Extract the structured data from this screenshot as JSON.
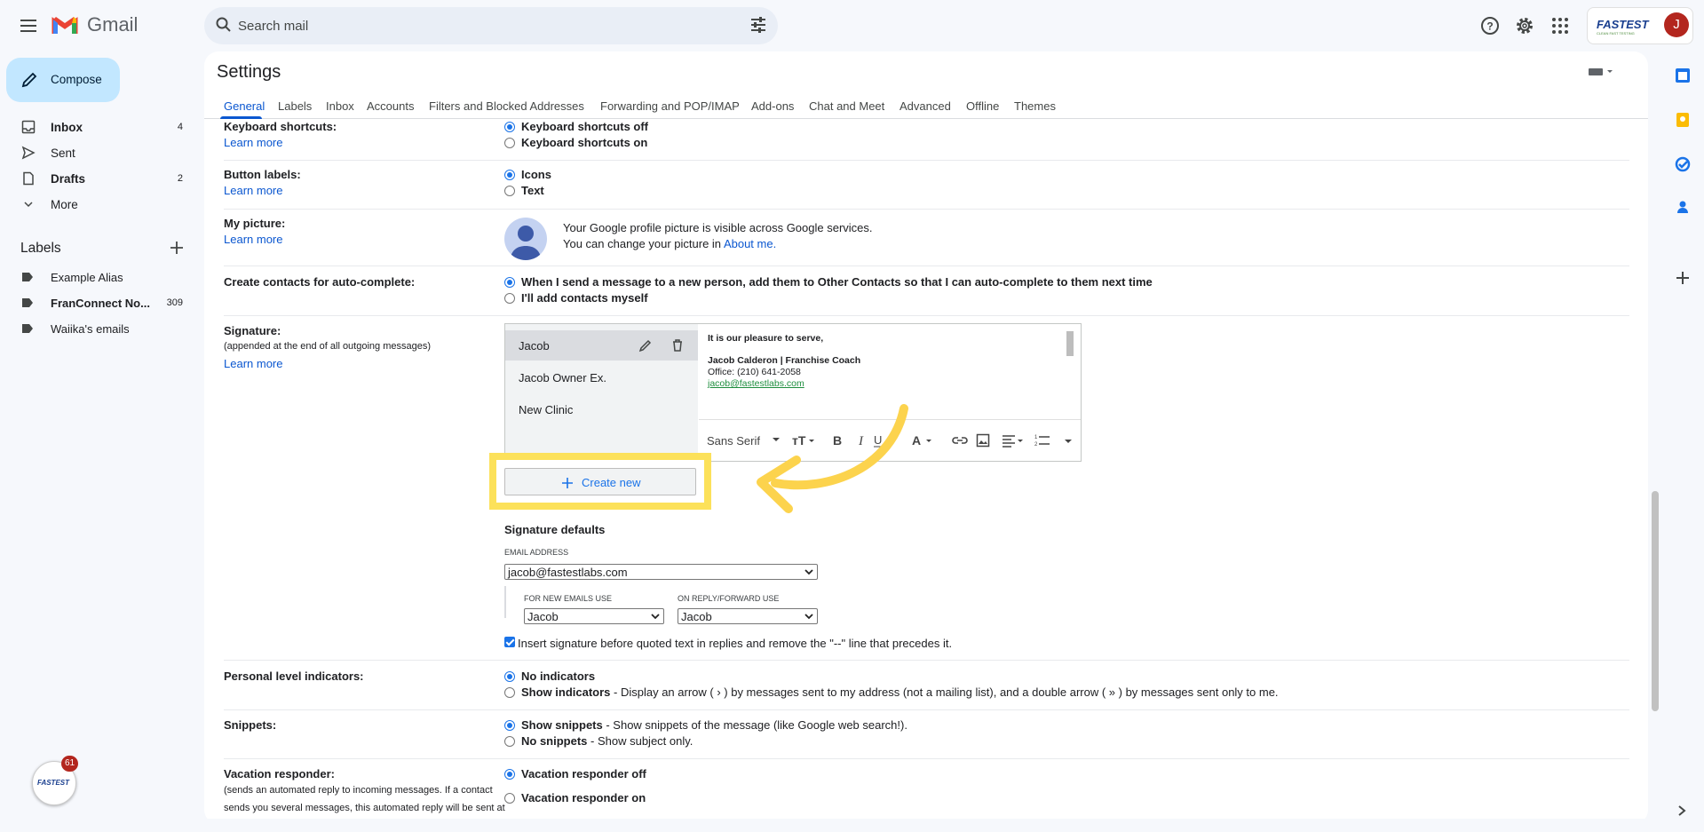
{
  "app": {
    "name": "Gmail"
  },
  "search": {
    "placeholder": "Search mail"
  },
  "account": {
    "brand": "FASTEST",
    "brand_sub": "CLEAN FAST TESTING",
    "avatar_letter": "J"
  },
  "sidebar": {
    "compose_label": "Compose",
    "items": [
      {
        "label": "Inbox",
        "count": "4"
      },
      {
        "label": "Sent",
        "count": ""
      },
      {
        "label": "Drafts",
        "count": "2"
      },
      {
        "label": "More",
        "count": ""
      }
    ],
    "labels_heading": "Labels",
    "labels": [
      {
        "label": "Example Alias",
        "count": ""
      },
      {
        "label": "FranConnect No...",
        "count": "309"
      },
      {
        "label": "Waiika's emails",
        "count": ""
      }
    ],
    "chat_badge": "61",
    "chat_brand": "FASTEST"
  },
  "settings": {
    "title": "Settings",
    "tabs": [
      "General",
      "Labels",
      "Inbox",
      "Accounts",
      "Filters and Blocked Addresses",
      "Forwarding and POP/IMAP",
      "Add-ons",
      "Chat and Meet",
      "Advanced",
      "Offline",
      "Themes"
    ],
    "learn_more": "Learn more",
    "keyboard": {
      "label": "Keyboard shortcuts:",
      "opt1": "Keyboard shortcuts off",
      "opt2": "Keyboard shortcuts on"
    },
    "buttons": {
      "label": "Button labels:",
      "opt1": "Icons",
      "opt2": "Text"
    },
    "picture": {
      "label": "My picture:",
      "line1": "Your Google profile picture is visible across Google services.",
      "line2": "You can change your picture in ",
      "link": "About me."
    },
    "contacts": {
      "label": "Create contacts for auto-complete:",
      "opt1": "When I send a message to a new person, add them to Other Contacts so that I can auto-complete to them next time",
      "opt2": "I'll add contacts myself"
    },
    "signature": {
      "label": "Signature:",
      "sub": "(appended at the end of all outgoing messages)",
      "items": [
        "Jacob",
        "Jacob Owner Ex.",
        "New Clinic"
      ],
      "text_line1": "It is our pleasure to serve,",
      "text_line2": "Jacob Calderon | Franchise Coach",
      "text_line3": "Office: (210) 641-2058",
      "text_link": "jacob@fastestlabs.com",
      "font": "Sans Serif",
      "create_new": "Create new",
      "defaults_title": "Signature defaults",
      "email_caption": "EMAIL ADDRESS",
      "email_value": "jacob@fastestlabs.com",
      "new_caption": "FOR NEW EMAILS USE",
      "new_value": "Jacob",
      "reply_caption": "ON REPLY/FORWARD USE",
      "reply_value": "Jacob",
      "insert_text": "Insert signature before quoted text in replies and remove the \"--\" line that precedes it."
    },
    "indicators": {
      "label": "Personal level indicators:",
      "opt1": "No indicators",
      "opt2_bold": "Show indicators",
      "opt2_rest": " - Display an arrow ( › ) by messages sent to my address (not a mailing list), and a double arrow ( » ) by messages sent only to me."
    },
    "snippets": {
      "label": "Snippets:",
      "opt1_bold": "Show snippets",
      "opt1_rest": " - Show snippets of the message (like Google web search!).",
      "opt2_bold": "No snippets",
      "opt2_rest": " - Show subject only."
    },
    "vacation": {
      "label": "Vacation responder:",
      "sub1": "(sends an automated reply to incoming messages. If a contact",
      "sub2": "sends you several messages, this automated reply will be sent at",
      "opt1": "Vacation responder off",
      "opt2": "Vacation responder on"
    }
  },
  "colors": {
    "accent": "#0b57d0",
    "highlight": "#fce15a",
    "compose_bg": "#c2e7ff"
  }
}
